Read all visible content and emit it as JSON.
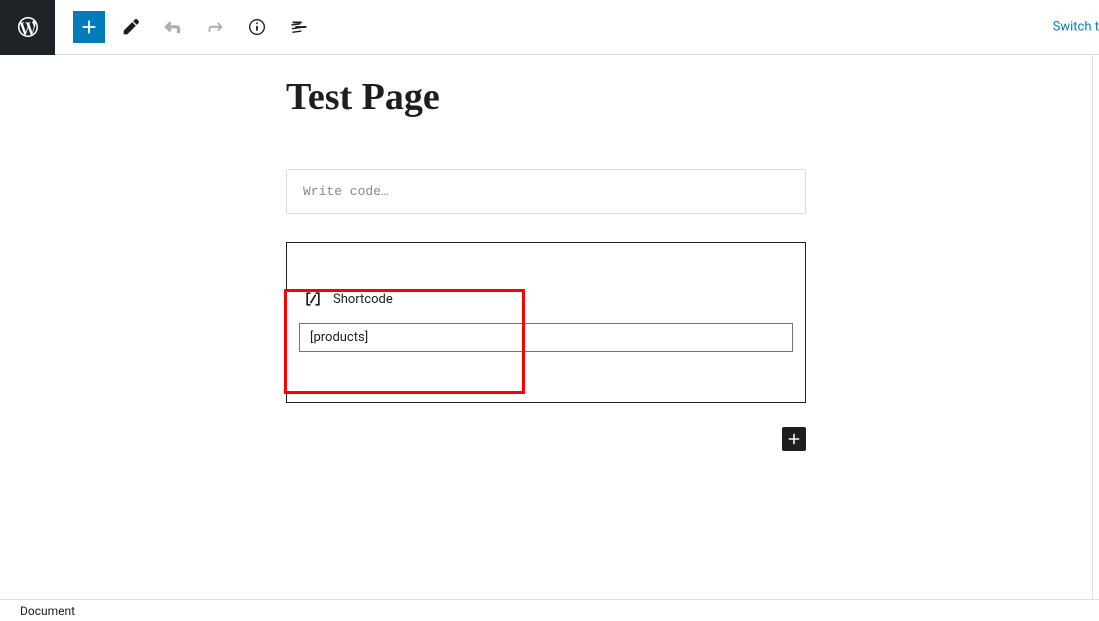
{
  "toolbar": {
    "switch_link": "Switch t"
  },
  "editor": {
    "page_title": "Test Page",
    "code_placeholder": "Write code…",
    "shortcode_label": "Shortcode",
    "shortcode_value": "[products]"
  },
  "footer": {
    "breadcrumb": "Document"
  }
}
